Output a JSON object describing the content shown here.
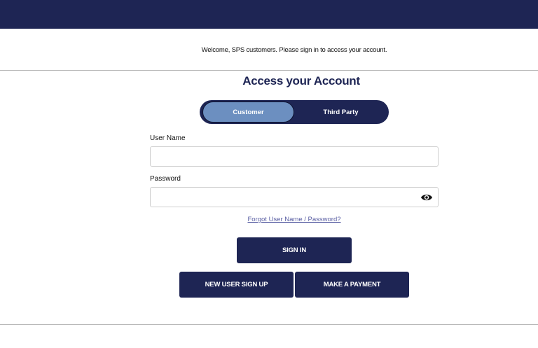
{
  "welcome_text": "Welcome, SPS customers. Please sign in to access your account.",
  "heading": "Access your Account",
  "toggle": {
    "options": [
      "Customer",
      "Third Party"
    ],
    "selected": "Customer"
  },
  "form": {
    "username_label": "User Name",
    "username_value": "",
    "password_label": "Password",
    "password_value": "",
    "show_password_icon": "eye-icon"
  },
  "forgot_link": "Forgot User Name / Password?",
  "buttons": {
    "sign_in": "SIGN IN",
    "new_user": "NEW USER SIGN UP",
    "payment": "MAKE A PAYMENT"
  },
  "colors": {
    "brand_navy": "#1e2554",
    "toggle_active": "#6c8fc0",
    "link": "#5a5fa3"
  }
}
